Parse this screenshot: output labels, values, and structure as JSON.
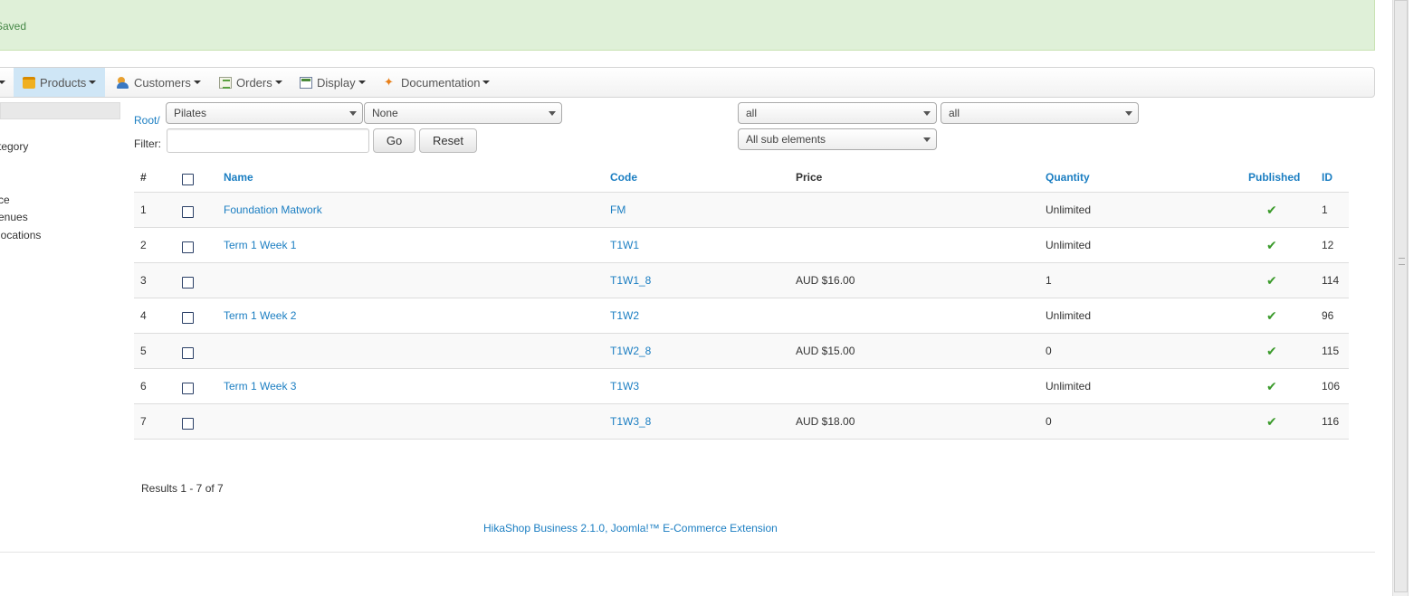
{
  "message": {
    "text": "Saved"
  },
  "menu": {
    "items": [
      {
        "label": "Products",
        "icon": "box-icon",
        "active": true
      },
      {
        "label": "Customers",
        "icon": "users-icon"
      },
      {
        "label": "Orders",
        "icon": "orders-icon"
      },
      {
        "label": "Display",
        "icon": "display-icon"
      },
      {
        "label": "Documentation",
        "icon": "documentation-icon"
      }
    ]
  },
  "sidebar": {
    "items": [
      "tegory",
      "ce",
      "enues",
      "locations"
    ]
  },
  "filters": {
    "breadcrumb": "Root/",
    "category_select": "Pilates",
    "second_select": "None",
    "published_select": "all",
    "variant_select": "all",
    "scope_select": "All sub elements",
    "filter_label": "Filter:",
    "filter_value": "",
    "go_label": "Go",
    "reset_label": "Reset"
  },
  "table": {
    "headers": {
      "num": "#",
      "name": "Name",
      "code": "Code",
      "price": "Price",
      "quantity": "Quantity",
      "published": "Published",
      "id": "ID"
    },
    "rows": [
      {
        "num": "1",
        "name": "Foundation Matwork",
        "code": "FM",
        "price": "",
        "quantity": "Unlimited",
        "published": "✔",
        "id": "1"
      },
      {
        "num": "2",
        "name": "Term 1 Week 1",
        "code": "T1W1",
        "price": "",
        "quantity": "Unlimited",
        "published": "✔",
        "id": "12"
      },
      {
        "num": "3",
        "name": "",
        "code": "T1W1_8",
        "price": "AUD $16.00",
        "quantity": "1",
        "published": "✔",
        "id": "114"
      },
      {
        "num": "4",
        "name": "Term 1 Week 2",
        "code": "T1W2",
        "price": "",
        "quantity": "Unlimited",
        "published": "✔",
        "id": "96"
      },
      {
        "num": "5",
        "name": "",
        "code": "T1W2_8",
        "price": "AUD $15.00",
        "quantity": "0",
        "published": "✔",
        "id": "115"
      },
      {
        "num": "6",
        "name": "Term 1 Week 3",
        "code": "T1W3",
        "price": "",
        "quantity": "Unlimited",
        "published": "✔",
        "id": "106"
      },
      {
        "num": "7",
        "name": "",
        "code": "T1W3_8",
        "price": "AUD $18.00",
        "quantity": "0",
        "published": "✔",
        "id": "116"
      }
    ]
  },
  "results_text": "Results 1 - 7 of 7",
  "footer_text": "HikaShop Business 2.1.0, Joomla!™ E-Commerce Extension",
  "colors": {
    "link": "#1b7ec2",
    "success_bg": "#dff0d8",
    "check": "#3a9a2a"
  }
}
